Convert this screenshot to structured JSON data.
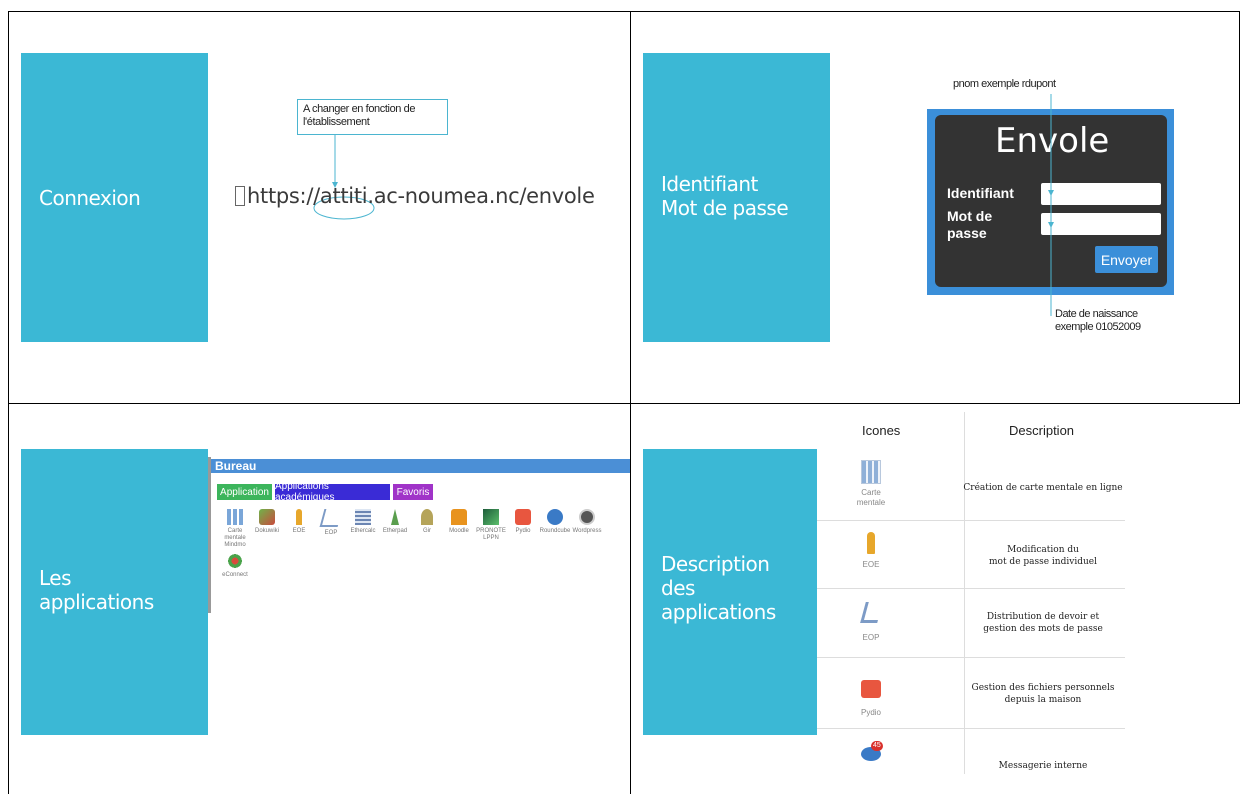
{
  "slides": {
    "connexion": {
      "title": "Connexion",
      "callout": "A changer en fonction de l'établissement",
      "url_glyph": "",
      "url": "https://attiti.ac-noumea.nc/envole"
    },
    "identifiant": {
      "title": "Identifiant\nMot de passe",
      "ann_top": "pnom  exemple rdupont",
      "login_title": "Envole",
      "label_id": "Identifiant",
      "label_pw": "Mot de\npasse",
      "button": "Envoyer",
      "ann_bottom": "Date de naissance\nexemple 01052009"
    },
    "applications": {
      "title": "Les\napplications",
      "bureau": "Bureau",
      "tabs": [
        "Application",
        "Applications académiques",
        "Favoris"
      ],
      "apps": [
        "Carte mentale Mindmo",
        "Dokuwiki",
        "EOE",
        "EOP",
        "Ethercalc",
        "Etherpad",
        "Gir",
        "Moodle",
        "PRONOTE LPPN",
        "Pydio",
        "Roundcube",
        "Wordpress"
      ],
      "apps_row2": [
        "eConnect"
      ]
    },
    "description": {
      "title": "Description\ndes\napplications",
      "col_icons": "Icones",
      "col_desc": "Description",
      "rows": [
        {
          "icon_label": "Carte\nmentale",
          "text": "Création de carte mentale en ligne"
        },
        {
          "icon_label": "EOE",
          "text": "Modification du\nmot de passe individuel"
        },
        {
          "icon_label": "EOP",
          "text": "Distribution de devoir et\ngestion des mots de passe"
        },
        {
          "icon_label": "Pydio",
          "text": "Gestion des fichiers personnels\ndepuis la maison"
        },
        {
          "icon_label": "",
          "text": "Messagerie interne"
        }
      ],
      "badge": "45"
    }
  },
  "colors": {
    "teal": "#3bb8d5",
    "blue": "#3b8fd9",
    "green": "#3cb55c",
    "indigo": "#3a2bd6",
    "purple": "#a033c8"
  }
}
